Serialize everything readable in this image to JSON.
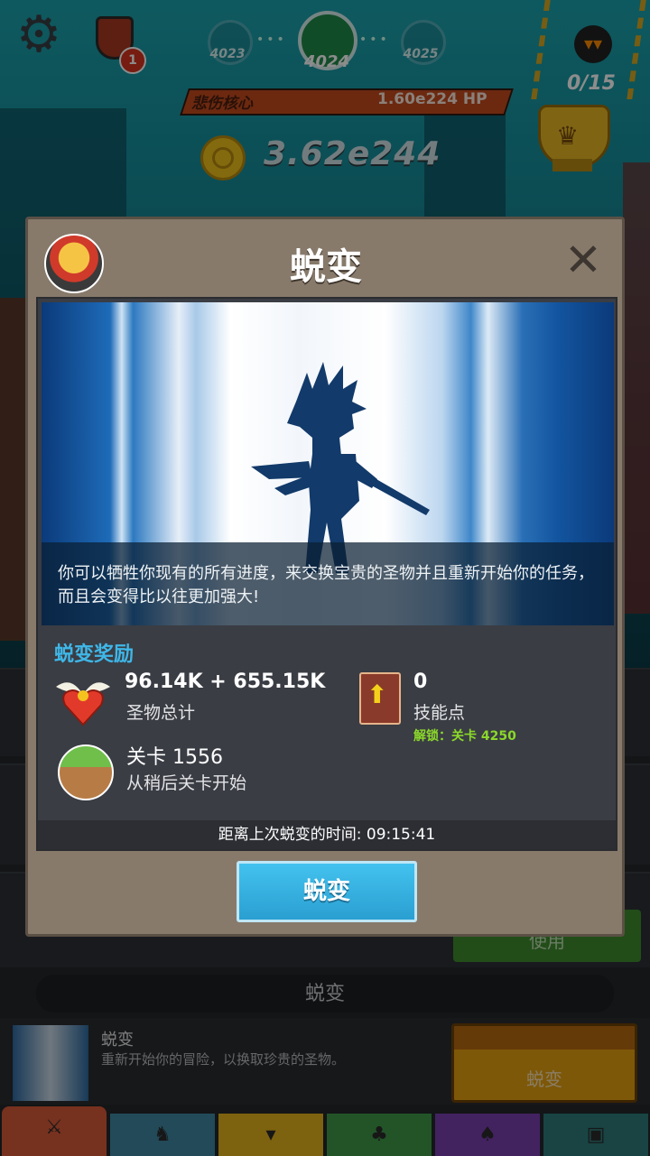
{
  "hud": {
    "notification_count": "1",
    "stages": {
      "prev": "4023",
      "current": "4024",
      "next": "4025"
    },
    "boss": {
      "name": "悲伤核心",
      "hp": "1.60e224 HP"
    },
    "gold": "3.62e244",
    "kill_progress": "0/15"
  },
  "dialog": {
    "title": "蜕变",
    "description": "你可以牺牲你现有的所有进度，来交换宝贵的圣物并且重新开始你的任务，而且会变得比以往更加强大!",
    "reward_title": "蜕变奖励",
    "relics": {
      "value": "96.14K + 655.15K",
      "label": "圣物总计"
    },
    "skill_points": {
      "value": "0",
      "label": "技能点",
      "unlock": "解锁：关卡 4250"
    },
    "stage": {
      "value": "关卡 1556",
      "label": "从稍后关卡开始"
    },
    "timer": "距离上次蜕变的时间: 09:15:41",
    "button_label": "蜕变"
  },
  "lower_panel": {
    "use_button": "使用",
    "section_title": "蜕变",
    "item": {
      "title": "蜕变",
      "description": "重新开始你的冒险，以换取珍贵的圣物。",
      "button": "蜕变"
    }
  },
  "tabs": [
    {
      "icon": "sword-icon",
      "color": "#d85a3a"
    },
    {
      "icon": "viking-helmet-icon",
      "color": "#3f87a2"
    },
    {
      "icon": "shirt-icon",
      "color": "#e4b21c"
    },
    {
      "icon": "pet-icon",
      "color": "#3f9a49"
    },
    {
      "icon": "bat-icon",
      "color": "#7a3fb0"
    },
    {
      "icon": "chest-icon",
      "color": "#2e7d7a"
    }
  ],
  "colors": {
    "accent_blue": "#3fb7e8",
    "unlock_green": "#8bd82a",
    "boss_bar": "#c54b1e"
  }
}
